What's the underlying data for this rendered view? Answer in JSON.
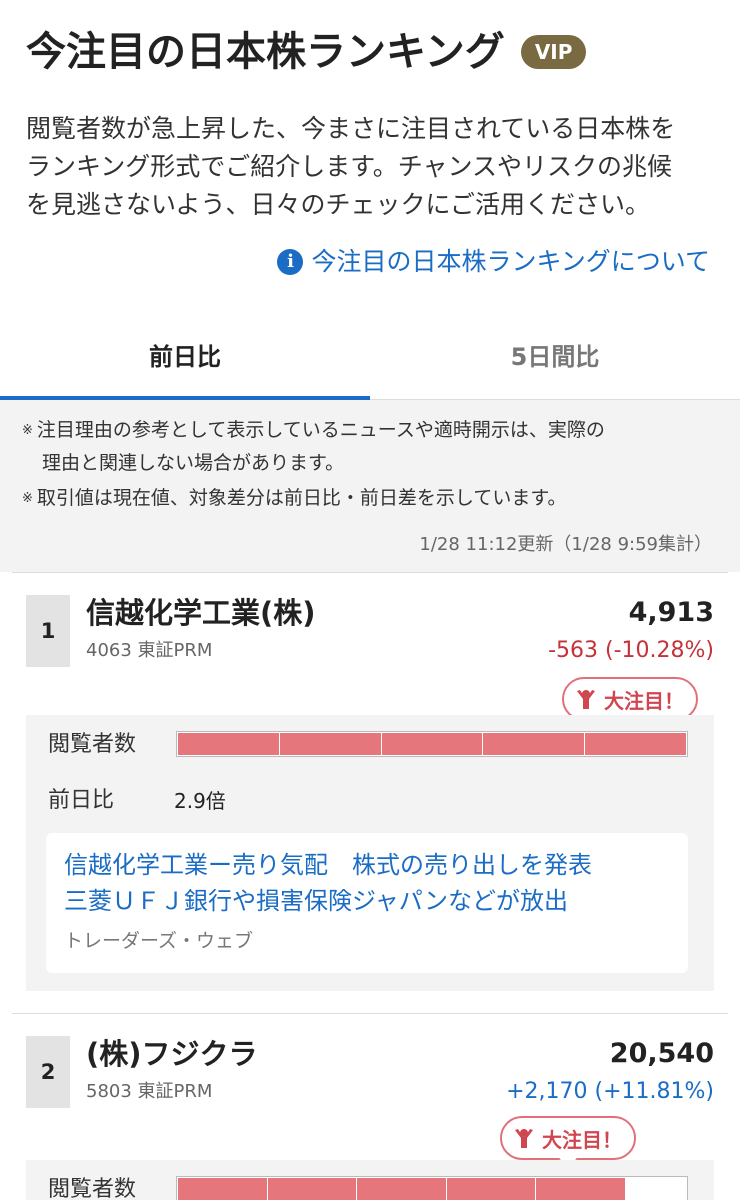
{
  "header": {
    "title": "今注目の日本株ランキング",
    "badge": "VIP"
  },
  "description": {
    "line1": "閲覧者数が急上昇した、今まさに注目されている日本株を",
    "line2": "ランキング形式でご紹介します。チャンスやリスクの兆候",
    "line3": "を見逃さないよう、日々のチェックにご活用ください。"
  },
  "about_link": {
    "icon": "info-icon",
    "label": "今注目の日本株ランキングについて"
  },
  "tabs": [
    {
      "label": "前日比",
      "active": true
    },
    {
      "label": "5日間比",
      "active": false
    }
  ],
  "notes": {
    "mark": "※",
    "note1_line1": "注目理由の参考として表示しているニュースや適時開示は、実際の",
    "note1_line2": "理由と関連しない場合があります。",
    "note2": "取引値は現在値、対象差分は前日比・前日差を示しています。",
    "updated": "1/28 11:12更新（1/28 9:59集計）"
  },
  "rankings": [
    {
      "rank": "1",
      "name": "信越化学工業(株)",
      "code": "4063 東証PRM",
      "price": "4,913",
      "change": "-563 (-10.28%)",
      "direction": "down",
      "badge": "大注目！",
      "viewers_label": "閲覧者数",
      "viewers_level": 1.0,
      "ratio_label": "前日比",
      "ratio_value": "2.9倍",
      "news_line1": "信越化学工業ー売り気配　株式の売り出しを発表",
      "news_line2": "三菱ＵＦＪ銀行や損害保険ジャパンなどが放出",
      "news_source": "トレーダーズ・ウェブ"
    },
    {
      "rank": "2",
      "name": "(株)フジクラ",
      "code": "5803 東証PRM",
      "price": "20,540",
      "change": "+2,170 (+11.81%)",
      "direction": "up",
      "badge": "大注目！",
      "viewers_label": "閲覧者数",
      "viewers_level": 0.88
    }
  ],
  "colors": {
    "accent": "#1a6cc4",
    "down": "#c4323a",
    "bar": "#e4767c",
    "vip": "#7a6a42"
  }
}
